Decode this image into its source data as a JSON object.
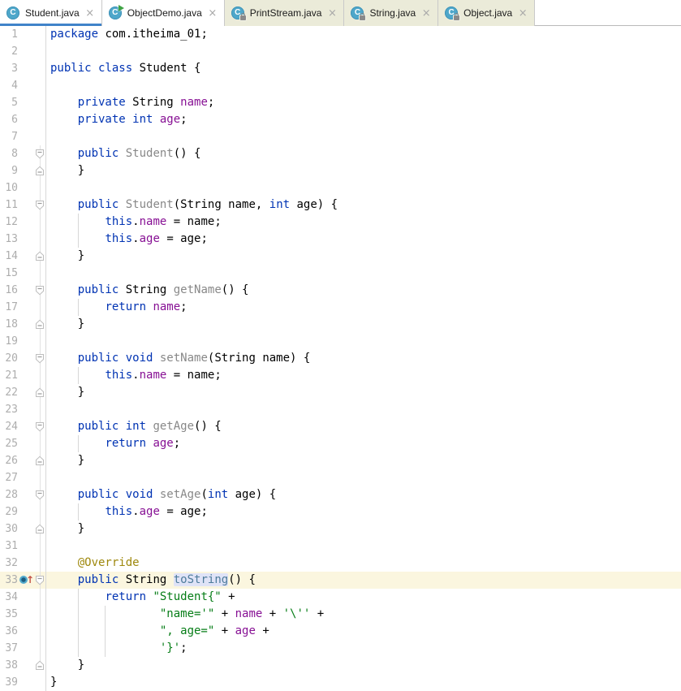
{
  "tab_bar": {
    "tabs": [
      {
        "label": "Student.java",
        "active": true,
        "library": false,
        "icon": "java-class-icon",
        "overlay": null,
        "close_glyph": "×"
      },
      {
        "label": "ObjectDemo.java",
        "active": false,
        "library": false,
        "icon": "java-class-icon",
        "overlay": "run",
        "close_glyph": "×"
      },
      {
        "label": "PrintStream.java",
        "active": false,
        "library": true,
        "icon": "java-class-icon",
        "overlay": "lock",
        "close_glyph": "×"
      },
      {
        "label": "String.java",
        "active": false,
        "library": true,
        "icon": "java-class-icon",
        "overlay": "lock",
        "close_glyph": "×"
      },
      {
        "label": "Object.java",
        "active": false,
        "library": true,
        "icon": "java-class-icon",
        "overlay": "lock",
        "close_glyph": "×"
      }
    ],
    "class_icon_letter": "C",
    "active_underline_color": "#4083c9",
    "library_tab_color": "#ebebd9"
  },
  "editor": {
    "colors": {
      "keyword": "#0033b3",
      "plain": "#000000",
      "field": "#871094",
      "string": "#067d17",
      "annotation": "#9e880d",
      "unused_member": "#888888",
      "caret_word_bg": "#dfe3f7",
      "caret_row_bg": "#fbf6df",
      "line_number": "#adadad",
      "class_icon_bg": "#4ea7ca"
    },
    "override_arrow_glyph": "↑",
    "lines": [
      {
        "n": 1,
        "seg": [
          [
            "kw",
            "package "
          ],
          [
            "pl",
            "com.itheima_01;"
          ]
        ]
      },
      {
        "n": 2
      },
      {
        "n": 3,
        "seg": [
          [
            "kw",
            "public class "
          ],
          [
            "pl",
            "Student {"
          ]
        ]
      },
      {
        "n": 4
      },
      {
        "n": 5,
        "seg": [
          [
            "pl",
            "    "
          ],
          [
            "kw",
            "private "
          ],
          [
            "pl",
            "String "
          ],
          [
            "fld",
            "name"
          ],
          [
            "pl",
            ";"
          ]
        ]
      },
      {
        "n": 6,
        "seg": [
          [
            "pl",
            "    "
          ],
          [
            "kw",
            "private int "
          ],
          [
            "fld",
            "age"
          ],
          [
            "pl",
            ";"
          ]
        ]
      },
      {
        "n": 7
      },
      {
        "n": 8,
        "fold": "open",
        "seg": [
          [
            "pl",
            "    "
          ],
          [
            "kw",
            "public "
          ],
          [
            "gm",
            "Student"
          ],
          [
            "pl",
            "() {"
          ]
        ]
      },
      {
        "n": 9,
        "fold": "close",
        "seg": [
          [
            "pl",
            "    }"
          ]
        ]
      },
      {
        "n": 10
      },
      {
        "n": 11,
        "fold": "open",
        "seg": [
          [
            "pl",
            "    "
          ],
          [
            "kw",
            "public "
          ],
          [
            "gm",
            "Student"
          ],
          [
            "pl",
            "(String name, "
          ],
          [
            "kw",
            "int"
          ],
          [
            "pl",
            " age) {"
          ]
        ]
      },
      {
        "n": 12,
        "g": [
          4
        ],
        "seg": [
          [
            "pl",
            "        "
          ],
          [
            "kw",
            "this"
          ],
          [
            "pl",
            "."
          ],
          [
            "fld",
            "name"
          ],
          [
            "pl",
            " = name;"
          ]
        ]
      },
      {
        "n": 13,
        "g": [
          4
        ],
        "seg": [
          [
            "pl",
            "        "
          ],
          [
            "kw",
            "this"
          ],
          [
            "pl",
            "."
          ],
          [
            "fld",
            "age"
          ],
          [
            "pl",
            " = age;"
          ]
        ]
      },
      {
        "n": 14,
        "fold": "close",
        "seg": [
          [
            "pl",
            "    }"
          ]
        ]
      },
      {
        "n": 15
      },
      {
        "n": 16,
        "fold": "open",
        "seg": [
          [
            "pl",
            "    "
          ],
          [
            "kw",
            "public "
          ],
          [
            "pl",
            "String "
          ],
          [
            "gm",
            "getName"
          ],
          [
            "pl",
            "() {"
          ]
        ]
      },
      {
        "n": 17,
        "g": [
          4
        ],
        "seg": [
          [
            "pl",
            "        "
          ],
          [
            "kw",
            "return "
          ],
          [
            "fld",
            "name"
          ],
          [
            "pl",
            ";"
          ]
        ]
      },
      {
        "n": 18,
        "fold": "close",
        "seg": [
          [
            "pl",
            "    }"
          ]
        ]
      },
      {
        "n": 19
      },
      {
        "n": 20,
        "fold": "open",
        "seg": [
          [
            "pl",
            "    "
          ],
          [
            "kw",
            "public void "
          ],
          [
            "gm",
            "setName"
          ],
          [
            "pl",
            "(String name) {"
          ]
        ]
      },
      {
        "n": 21,
        "g": [
          4
        ],
        "seg": [
          [
            "pl",
            "        "
          ],
          [
            "kw",
            "this"
          ],
          [
            "pl",
            "."
          ],
          [
            "fld",
            "name"
          ],
          [
            "pl",
            " = name;"
          ]
        ]
      },
      {
        "n": 22,
        "fold": "close",
        "seg": [
          [
            "pl",
            "    }"
          ]
        ]
      },
      {
        "n": 23
      },
      {
        "n": 24,
        "fold": "open",
        "seg": [
          [
            "pl",
            "    "
          ],
          [
            "kw",
            "public int "
          ],
          [
            "gm",
            "getAge"
          ],
          [
            "pl",
            "() {"
          ]
        ]
      },
      {
        "n": 25,
        "g": [
          4
        ],
        "seg": [
          [
            "pl",
            "        "
          ],
          [
            "kw",
            "return "
          ],
          [
            "fld",
            "age"
          ],
          [
            "pl",
            ";"
          ]
        ]
      },
      {
        "n": 26,
        "fold": "close",
        "seg": [
          [
            "pl",
            "    }"
          ]
        ]
      },
      {
        "n": 27
      },
      {
        "n": 28,
        "fold": "open",
        "seg": [
          [
            "pl",
            "    "
          ],
          [
            "kw",
            "public void "
          ],
          [
            "gm",
            "setAge"
          ],
          [
            "pl",
            "("
          ],
          [
            "kw",
            "int"
          ],
          [
            "pl",
            " age) {"
          ]
        ]
      },
      {
        "n": 29,
        "g": [
          4
        ],
        "seg": [
          [
            "pl",
            "        "
          ],
          [
            "kw",
            "this"
          ],
          [
            "pl",
            "."
          ],
          [
            "fld",
            "age"
          ],
          [
            "pl",
            " = age;"
          ]
        ]
      },
      {
        "n": 30,
        "fold": "close",
        "seg": [
          [
            "pl",
            "    }"
          ]
        ]
      },
      {
        "n": 31
      },
      {
        "n": 32,
        "seg": [
          [
            "pl",
            "    "
          ],
          [
            "ann",
            "@Override"
          ]
        ]
      },
      {
        "n": 33,
        "fold": "open",
        "ovr": true,
        "caret": true,
        "seg": [
          [
            "pl",
            "    "
          ],
          [
            "kw",
            "public "
          ],
          [
            "pl",
            "String "
          ],
          [
            "cw",
            "toString"
          ],
          [
            "pl",
            "() {"
          ]
        ]
      },
      {
        "n": 34,
        "g": [
          4
        ],
        "seg": [
          [
            "pl",
            "        "
          ],
          [
            "kw",
            "return "
          ],
          [
            "str",
            "\"Student{\""
          ],
          [
            "pl",
            " +"
          ]
        ]
      },
      {
        "n": 35,
        "g": [
          4,
          8
        ],
        "seg": [
          [
            "pl",
            "                "
          ],
          [
            "str",
            "\"name='\""
          ],
          [
            "pl",
            " + "
          ],
          [
            "fld",
            "name"
          ],
          [
            "pl",
            " + "
          ],
          [
            "str",
            "'\\''"
          ],
          [
            "pl",
            " +"
          ]
        ]
      },
      {
        "n": 36,
        "g": [
          4,
          8
        ],
        "seg": [
          [
            "pl",
            "                "
          ],
          [
            "str",
            "\", age=\""
          ],
          [
            "pl",
            " + "
          ],
          [
            "fld",
            "age"
          ],
          [
            "pl",
            " +"
          ]
        ]
      },
      {
        "n": 37,
        "g": [
          4,
          8
        ],
        "seg": [
          [
            "pl",
            "                "
          ],
          [
            "str",
            "'}'"
          ],
          [
            "pl",
            ";"
          ]
        ]
      },
      {
        "n": 38,
        "fold": "close",
        "seg": [
          [
            "pl",
            "    }"
          ]
        ]
      },
      {
        "n": 39,
        "seg": [
          [
            "pl",
            "}"
          ]
        ]
      }
    ]
  }
}
